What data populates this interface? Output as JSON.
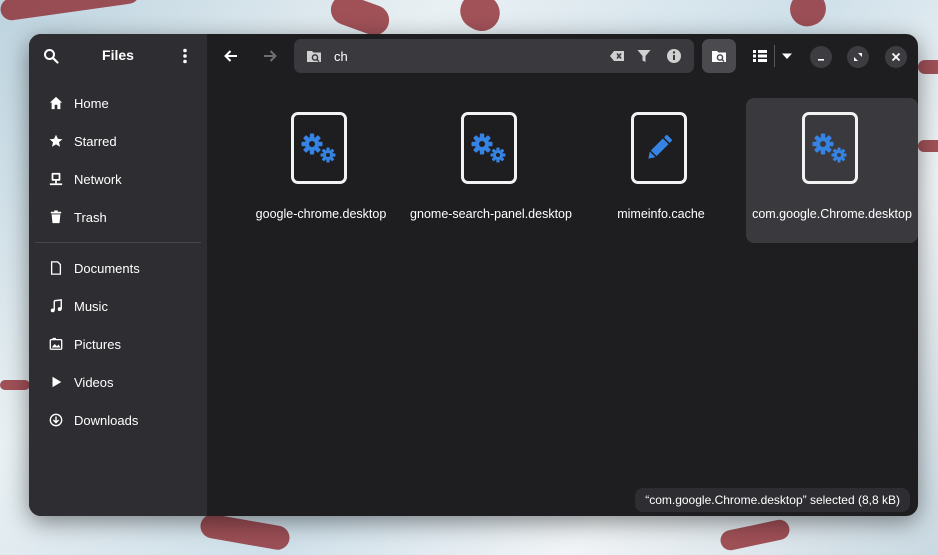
{
  "sidebar": {
    "title": "Files",
    "places": [
      {
        "label": "Home",
        "icon": "home-icon"
      },
      {
        "label": "Starred",
        "icon": "star-icon"
      },
      {
        "label": "Network",
        "icon": "network-icon"
      },
      {
        "label": "Trash",
        "icon": "trash-icon"
      }
    ],
    "bookmarks": [
      {
        "label": "Documents",
        "icon": "document-icon"
      },
      {
        "label": "Music",
        "icon": "music-icon"
      },
      {
        "label": "Pictures",
        "icon": "pictures-icon"
      },
      {
        "label": "Videos",
        "icon": "videos-icon"
      },
      {
        "label": "Downloads",
        "icon": "downloads-icon"
      }
    ]
  },
  "toolbar": {
    "search_value": "ch"
  },
  "files": [
    {
      "name": "google-chrome.desktop",
      "icon": "settings-file-icon",
      "selected": false
    },
    {
      "name": "gnome-search-panel.desktop",
      "icon": "settings-file-icon",
      "selected": false
    },
    {
      "name": "mimeinfo.cache",
      "icon": "text-file-icon",
      "selected": false
    },
    {
      "name": "com.google.Chrome.desktop",
      "icon": "settings-file-icon",
      "selected": true
    }
  ],
  "status": {
    "text": "“com.google.Chrome.desktop” selected  (8,8 kB)"
  },
  "colors": {
    "accent": "#3584e4",
    "window_bg": "#1e1e21",
    "sidebar_bg": "#2e2e32"
  }
}
